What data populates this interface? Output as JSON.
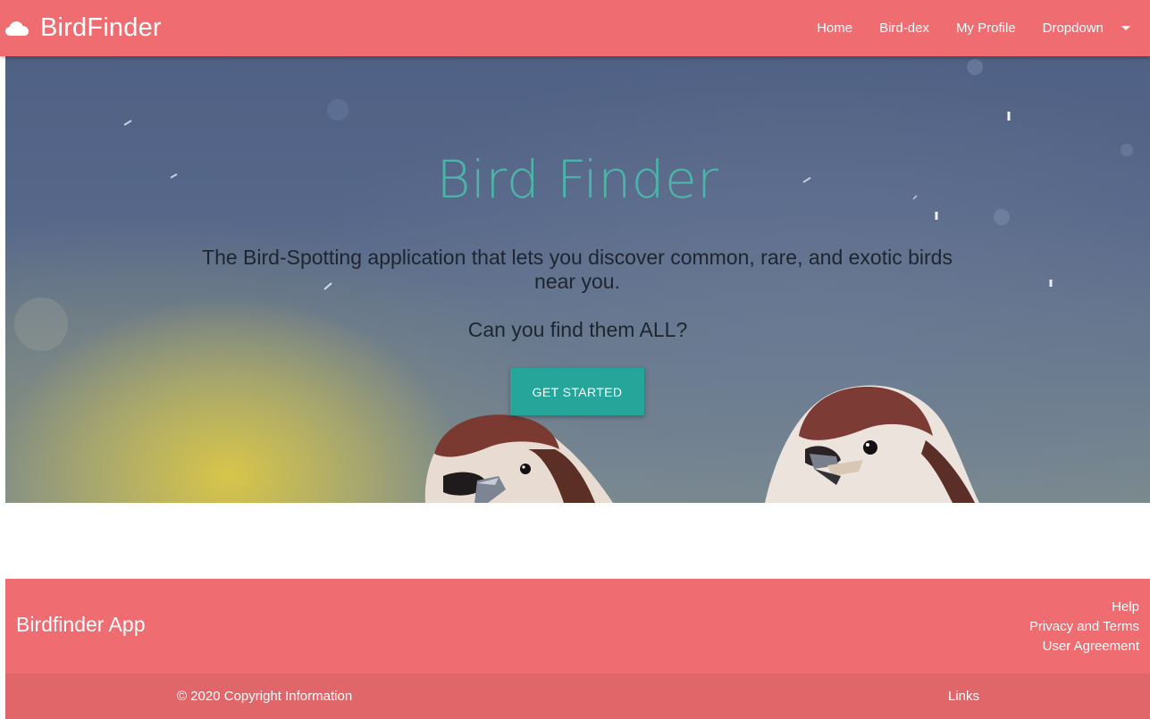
{
  "navbar": {
    "brand": "BirdFinder",
    "brand_icon": "cloud-icon",
    "links": [
      "Home",
      "Bird-dex",
      "My Profile"
    ],
    "dropdown_label": "Dropdown",
    "dropdown_icon": "caret-down-icon",
    "background_color": "#ef6c70"
  },
  "hero": {
    "title": "Bird Finder",
    "subtitle": "The Bird-Spotting application that lets you discover common, rare, and exotic birds near you.",
    "question": "Can you find them ALL?",
    "cta_label": "GET STARTED",
    "title_color": "#4cb5aa",
    "cta_color": "#26a69a"
  },
  "footer": {
    "title": "Birdfinder App",
    "links": [
      "Help",
      "Privacy and Terms",
      "User Agreement"
    ],
    "copyright": "© 2020 Copyright Information",
    "bottom_link": "Links"
  }
}
